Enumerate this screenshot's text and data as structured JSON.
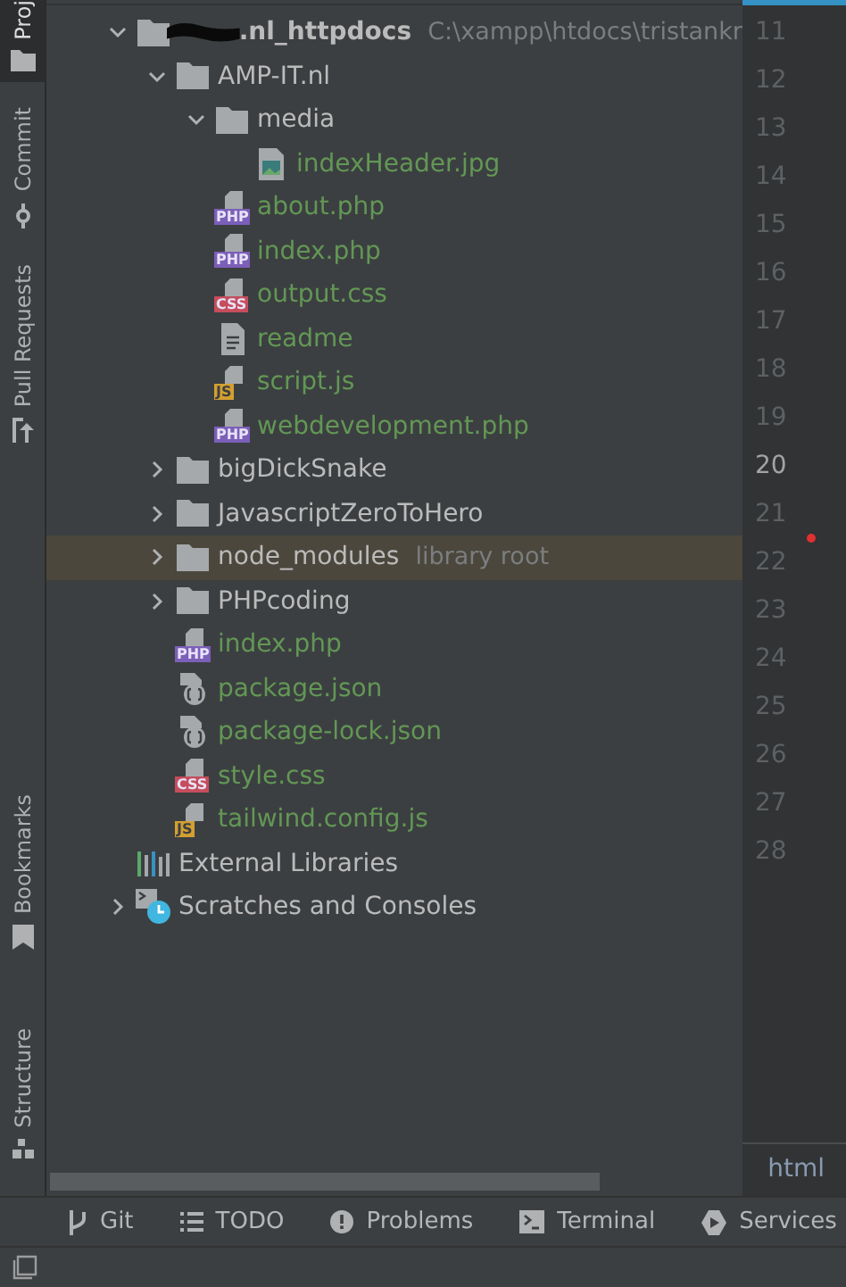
{
  "tool_stripe": {
    "top": [
      {
        "label": "Proj",
        "kind": "folder",
        "selected": true
      },
      {
        "label": "Commit",
        "kind": "commit",
        "selected": false
      },
      {
        "label": "Pull Requests",
        "kind": "pull",
        "selected": false
      }
    ],
    "bottom": [
      {
        "label": "Bookmarks",
        "kind": "bookmark",
        "selected": false
      },
      {
        "label": "Structure",
        "kind": "structure",
        "selected": false
      }
    ]
  },
  "tree": [
    {
      "name": ".nl_httpdocs",
      "hint": "C:\\xampp\\htdocs\\tristankr",
      "kind": "folder",
      "expanded": true,
      "redacted": true,
      "bold": true,
      "added": false,
      "selected": false,
      "children": [
        {
          "name": "AMP-IT.nl",
          "kind": "folder",
          "expanded": true,
          "added": false,
          "selected": false,
          "children": [
            {
              "name": "media",
              "kind": "folder",
              "expanded": true,
              "added": false,
              "selected": false,
              "children": [
                {
                  "name": "indexHeader.jpg",
                  "kind": "image",
                  "added": true,
                  "selected": false
                }
              ]
            },
            {
              "name": "about.php",
              "kind": "file",
              "badge": "PHP",
              "added": true,
              "selected": false
            },
            {
              "name": "index.php",
              "kind": "file",
              "badge": "PHP",
              "added": true,
              "selected": false
            },
            {
              "name": "output.css",
              "kind": "file",
              "badge": "CSS",
              "added": true,
              "selected": false
            },
            {
              "name": "readme",
              "kind": "text",
              "added": true,
              "selected": false
            },
            {
              "name": "script.js",
              "kind": "file",
              "badge": "JS",
              "added": true,
              "selected": false
            },
            {
              "name": "webdevelopment.php",
              "kind": "file",
              "badge": "PHP",
              "added": true,
              "selected": false
            }
          ]
        },
        {
          "name": "bigDickSnake",
          "kind": "folder",
          "expanded": false,
          "added": false,
          "selected": false
        },
        {
          "name": "JavascriptZeroToHero",
          "kind": "folder",
          "expanded": false,
          "added": false,
          "selected": false
        },
        {
          "name": "node_modules",
          "hint": "library root",
          "kind": "folder",
          "expanded": false,
          "added": false,
          "selected": true
        },
        {
          "name": "PHPcoding",
          "kind": "folder",
          "expanded": false,
          "added": false,
          "selected": false
        },
        {
          "name": "index.php",
          "kind": "file",
          "badge": "PHP",
          "added": true,
          "selected": false
        },
        {
          "name": "package.json",
          "kind": "json",
          "added": true,
          "selected": false
        },
        {
          "name": "package-lock.json",
          "kind": "json",
          "added": true,
          "selected": false
        },
        {
          "name": "style.css",
          "kind": "file",
          "badge": "CSS",
          "added": true,
          "selected": false
        },
        {
          "name": "tailwind.config.js",
          "kind": "file",
          "badge": "JS",
          "added": true,
          "selected": false
        }
      ]
    },
    {
      "name": "External Libraries",
      "kind": "library",
      "added": false,
      "selected": false
    },
    {
      "name": "Scratches and Consoles",
      "kind": "scratches",
      "expanded": false,
      "added": false,
      "selected": false
    }
  ],
  "gutter": {
    "lines": [
      {
        "number": "11",
        "current": false
      },
      {
        "number": "12",
        "current": false
      },
      {
        "number": "13",
        "current": false
      },
      {
        "number": "14",
        "current": false
      },
      {
        "number": "15",
        "current": false
      },
      {
        "number": "16",
        "current": false
      },
      {
        "number": "17",
        "current": false
      },
      {
        "number": "18",
        "current": false
      },
      {
        "number": "19",
        "current": false
      },
      {
        "number": "20",
        "current": true
      },
      {
        "number": "21",
        "current": false
      },
      {
        "number": "22",
        "current": false
      },
      {
        "number": "23",
        "current": false
      },
      {
        "number": "24",
        "current": false
      },
      {
        "number": "25",
        "current": false
      },
      {
        "number": "26",
        "current": false
      },
      {
        "number": "27",
        "current": false
      },
      {
        "number": "28",
        "current": false
      }
    ],
    "language": "html"
  },
  "bottom_tabs": [
    {
      "label": "Git",
      "kind": "git"
    },
    {
      "label": "TODO",
      "kind": "list"
    },
    {
      "label": "Problems",
      "kind": "problems"
    },
    {
      "label": "Terminal",
      "kind": "terminal"
    },
    {
      "label": "Services",
      "kind": "services"
    }
  ]
}
